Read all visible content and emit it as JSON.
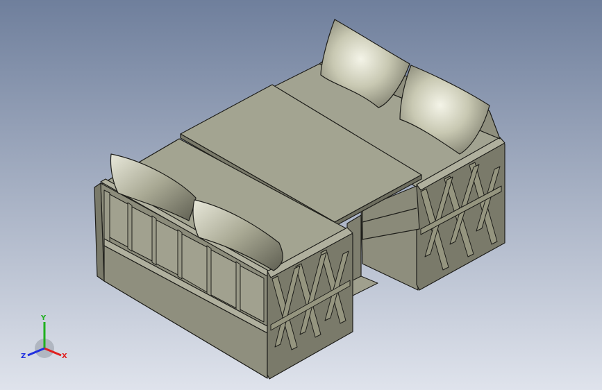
{
  "scene": {
    "colors": {
      "background_top": "#6f7f9c",
      "background_bottom": "#dfe3ec",
      "body_light": "#a3a493",
      "body_mid": "#8f8f7e",
      "body_dark": "#6e6e5f",
      "edge": "#1e1e1a",
      "cushion": "#c8c8b2"
    }
  },
  "triad": {
    "labels": {
      "x": "X",
      "y": "Y",
      "z": "Z"
    },
    "colors": {
      "x": "#e02020",
      "y": "#20b020",
      "z": "#2030e0"
    }
  }
}
